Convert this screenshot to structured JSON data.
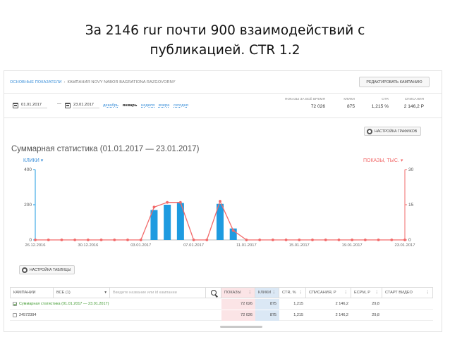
{
  "slide": {
    "title_line1": "За 2146 rur почти 900 взаимодействий с",
    "title_line2": "публикацией. CTR 1.2"
  },
  "breadcrumb": {
    "link": "ОСНОВНЫЕ ПОКАЗАТЕЛИ",
    "separator": "›",
    "current": "КАМПАНИЯ NOVY NABOR BAGRATIONA RAZGOVORNY"
  },
  "buttons": {
    "edit_campaign": "РЕДАКТИРОВАТЬ КАМПАНИЮ",
    "chart_settings": "НАСТРОЙКА ГРАФИКОВ",
    "table_settings": "НАСТРОЙКА ТАБЛИЦЫ"
  },
  "date_range": {
    "from": "01.01.2017",
    "dash": "—",
    "to": "23.01.2017",
    "periods": [
      "декабрь",
      "январь",
      "неделя",
      "вчера",
      "сегодня"
    ],
    "active_period": "январь"
  },
  "metrics": [
    {
      "label": "ПОКАЗЫ ЗА ВСЁ ВРЕМЯ",
      "value": "72 026"
    },
    {
      "label": "КЛИКИ",
      "value": "875"
    },
    {
      "label": "CTR",
      "value": "1,215 %"
    },
    {
      "label": "СПИСАНИЯ",
      "value": "2 146,2 Р"
    }
  ],
  "chart_header": {
    "title": "Суммарная статистика (01.01.2017 — 23.01.2017)",
    "left_legend": "КЛИКИ ▾",
    "right_legend": "ПОКАЗЫ, ТЫС. ▾"
  },
  "chart_data": {
    "type": "bar",
    "title": "Суммарная статистика (01.01.2017 — 23.01.2017)",
    "x_tick_labels": [
      "26.12.2016",
      "30.12.2016",
      "03.01.2017",
      "07.01.2017",
      "11.01.2017",
      "15.01.2017",
      "19.01.2017",
      "23.01.2017"
    ],
    "x_day_range": [
      "2016-12-26",
      "2017-01-23"
    ],
    "left_axis": {
      "ticks": [
        "0",
        "200",
        "400"
      ],
      "ylim": [
        0,
        400
      ]
    },
    "right_axis": {
      "ticks": [
        "0",
        "15",
        "30"
      ],
      "ylim": [
        0,
        30
      ]
    },
    "series": [
      {
        "name": "КЛИКИ",
        "kind": "bar",
        "color": "#1e9be0",
        "points": [
          {
            "date": "2017-01-04",
            "value": 170
          },
          {
            "date": "2017-01-05",
            "value": 200
          },
          {
            "date": "2017-01-06",
            "value": 210
          },
          {
            "date": "2017-01-09",
            "value": 205
          },
          {
            "date": "2017-01-10",
            "value": 65
          }
        ]
      },
      {
        "name": "ПОКАЗЫ, ТЫС.",
        "kind": "line",
        "color": "#f26a6a",
        "points": [
          {
            "date": "2016-12-26",
            "value": 0
          },
          {
            "date": "2016-12-27",
            "value": 0
          },
          {
            "date": "2016-12-28",
            "value": 0
          },
          {
            "date": "2016-12-29",
            "value": 0
          },
          {
            "date": "2016-12-30",
            "value": 0
          },
          {
            "date": "2016-12-31",
            "value": 0
          },
          {
            "date": "2017-01-01",
            "value": 0
          },
          {
            "date": "2017-01-02",
            "value": 0
          },
          {
            "date": "2017-01-03",
            "value": 0
          },
          {
            "date": "2017-01-04",
            "value": 14
          },
          {
            "date": "2017-01-05",
            "value": 16
          },
          {
            "date": "2017-01-06",
            "value": 16
          },
          {
            "date": "2017-01-07",
            "value": 0
          },
          {
            "date": "2017-01-08",
            "value": 0
          },
          {
            "date": "2017-01-09",
            "value": 16.5
          },
          {
            "date": "2017-01-10",
            "value": 4
          },
          {
            "date": "2017-01-11",
            "value": 0
          },
          {
            "date": "2017-01-12",
            "value": 0
          },
          {
            "date": "2017-01-13",
            "value": 0
          },
          {
            "date": "2017-01-14",
            "value": 0
          },
          {
            "date": "2017-01-15",
            "value": 0
          },
          {
            "date": "2017-01-16",
            "value": 0
          },
          {
            "date": "2017-01-17",
            "value": 0
          },
          {
            "date": "2017-01-18",
            "value": 0
          },
          {
            "date": "2017-01-19",
            "value": 0
          },
          {
            "date": "2017-01-20",
            "value": 0
          },
          {
            "date": "2017-01-21",
            "value": 0
          },
          {
            "date": "2017-01-22",
            "value": 0
          },
          {
            "date": "2017-01-23",
            "value": 0
          }
        ]
      }
    ],
    "grid": false
  },
  "table": {
    "filter": {
      "campaigns_label": "КАМПАНИИ",
      "all_select": "ВСЕ (1)",
      "select_arrow": "▾",
      "search_placeholder": "Введите название или id кампании"
    },
    "columns": [
      "ПОКАЗЫ",
      "КЛИКИ",
      "CTR, %",
      "СПИСАНИЯ, Р",
      "ECPM, Р",
      "СТАРТ ВИДЕО"
    ],
    "sort_marks": [
      "⋮",
      "⋮",
      "⋮",
      "⋮",
      "⋮",
      "⋮"
    ],
    "rows": [
      {
        "name": "Суммарная статистика (01.01.2017 — 23.01.2017)",
        "checked": true,
        "values": [
          "72 026",
          "875",
          "1,215",
          "2 146,2",
          "29,8",
          ""
        ]
      },
      {
        "name": "24572394",
        "checked": false,
        "values": [
          "72 026",
          "875",
          "1,215",
          "2 146,2",
          "29,8",
          ""
        ]
      }
    ]
  }
}
